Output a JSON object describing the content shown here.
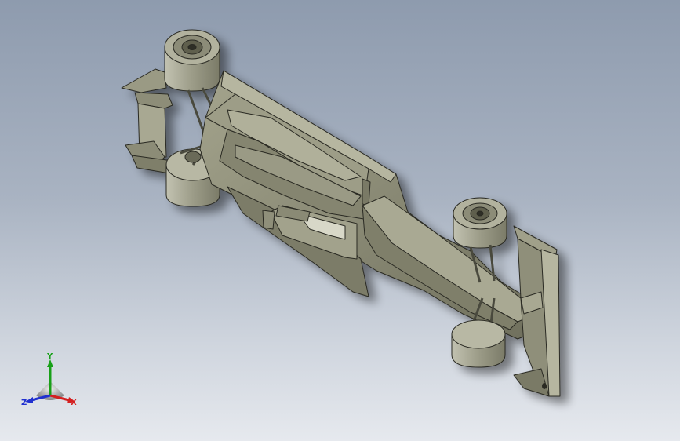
{
  "viewport": {
    "background_top": "#8e9bae",
    "background_bottom": "#e6e9ee",
    "model_color": "#8f8f7a",
    "edge_color": "#2a2a24"
  },
  "triad": {
    "x_label": "X",
    "y_label": "Y",
    "z_label": "Z",
    "x_color": "#d42020",
    "y_color": "#18a018",
    "z_color": "#2030d0"
  }
}
